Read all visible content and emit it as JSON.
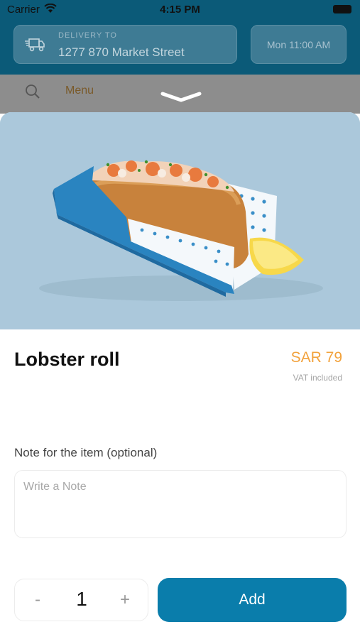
{
  "status_bar": {
    "carrier": "Carrier",
    "time": "4:15 PM"
  },
  "header": {
    "delivery_label": "DELIVERY TO",
    "address": "1277 870 Market Street",
    "time_slot": "Mon 11:00 AM"
  },
  "menu_bar": {
    "menu_label": "Menu"
  },
  "item": {
    "name": "Lobster roll",
    "price": "SAR 79",
    "vat_note": "VAT included"
  },
  "note": {
    "label": "Note for the item (optional)",
    "placeholder": "Write a Note",
    "value": ""
  },
  "order": {
    "minus_label": "-",
    "quantity": "1",
    "plus_label": "+",
    "add_label": "Add"
  },
  "colors": {
    "header_bg": "#0b5a78",
    "price": "#f2a23c",
    "add_button": "#0a7dab",
    "hero_bg": "#abc8db"
  },
  "icons": [
    "wifi-icon",
    "battery-icon",
    "delivery-truck-icon",
    "search-icon",
    "chevron-down-icon"
  ]
}
